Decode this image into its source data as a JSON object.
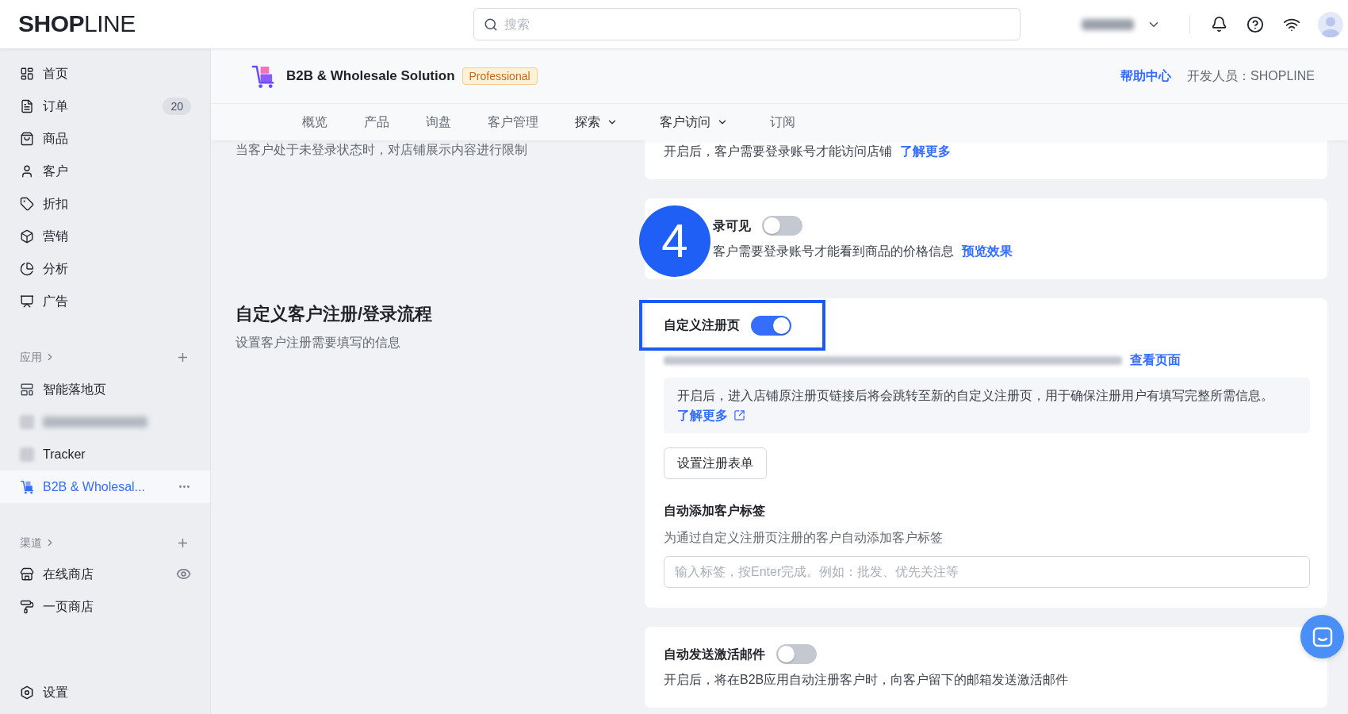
{
  "top_bar": {
    "logo": "**SHOP**LINE",
    "search": {
      "placeholder": "搜索"
    }
  },
  "sidebar": {
    "main_items": [
      {
        "label": "首页",
        "selected": false
      },
      {
        "label": "订单",
        "selected": false,
        "badge": "20"
      },
      {
        "label": "商品",
        "selected": false
      },
      {
        "label": "客户",
        "selected": false
      },
      {
        "label": "折扣",
        "selected": false
      },
      {
        "label": "营销",
        "selected": false
      },
      {
        "label": "分析",
        "selected": false
      },
      {
        "label": "广告",
        "selected": false
      }
    ],
    "apps_header": "应用",
    "apps": [
      {
        "kind": "app",
        "label": "智能落地页",
        "selected": false
      },
      {
        "kind": "redacted",
        "selected": false
      },
      {
        "kind": "app",
        "label": "Tracker",
        "selected": false
      },
      {
        "kind": "app",
        "label": "B2B & Wholesal...",
        "selected": true
      }
    ],
    "channels_header": "渠道",
    "channels": [
      {
        "label": "在线商店",
        "selected": false
      },
      {
        "label": "一页商店",
        "selected": false
      }
    ],
    "settings_item": {
      "label": "设置"
    }
  },
  "app_header": {
    "title": "B2B & Wholesale Solution",
    "plan_badge": "Professional",
    "help_link": "帮助中心",
    "developer": "开发人员：SHOPLINE"
  },
  "tabs": [
    {
      "label": "概览",
      "kind": "plain",
      "selected": false
    },
    {
      "label": "产品",
      "kind": "plain",
      "selected": false
    },
    {
      "label": "询盘",
      "kind": "plain",
      "selected": false
    },
    {
      "label": "客户管理",
      "kind": "plain",
      "selected": false
    },
    {
      "label": "探索",
      "kind": "dropdown",
      "selected": false
    },
    {
      "label": "客户访问",
      "kind": "dropdown",
      "selected": false
    },
    {
      "label": "订阅",
      "kind": "plain",
      "selected": false
    }
  ],
  "sections": [
    {
      "description": "当客户处于未登录状态时，对店铺展示内容进行限制",
      "cards": [
        {
          "kind": "note",
          "description": "开启后，客户需要登录账号才能访问店铺",
          "link": "了解更多"
        },
        {
          "kind": "toggle",
          "step_marker": "4",
          "label": "录可见",
          "on": false,
          "description": "客户需要登录账号才能看到商品的价格信息",
          "link": "预览效果"
        }
      ]
    },
    {
      "title": "自定义客户注册/登录流程",
      "description": "设置客户注册需要填写的信息",
      "cards": [
        {
          "kind": "registration",
          "label": "自定义注册页",
          "on": true,
          "highlighted": true,
          "url_link": "查看页面",
          "notice": {
            "text": "开启后，进入店铺原注册页链接后将会跳转至新的自定义注册页，用于确保注册用户有填写完整所需信息。",
            "link": "了解更多"
          },
          "button": "设置注册表单",
          "tags": {
            "title": "自动添加客户标签",
            "description": "为通过自定义注册页注册的客户自动添加客户标签",
            "placeholder": "输入标签，按Enter完成。例如：批发、优先关注等"
          }
        },
        {
          "kind": "toggle",
          "label": "自动发送激活邮件",
          "on": false,
          "description": "开启后，将在B2B应用自动注册客户时，向客户留下的邮箱发送激活邮件"
        }
      ]
    }
  ]
}
